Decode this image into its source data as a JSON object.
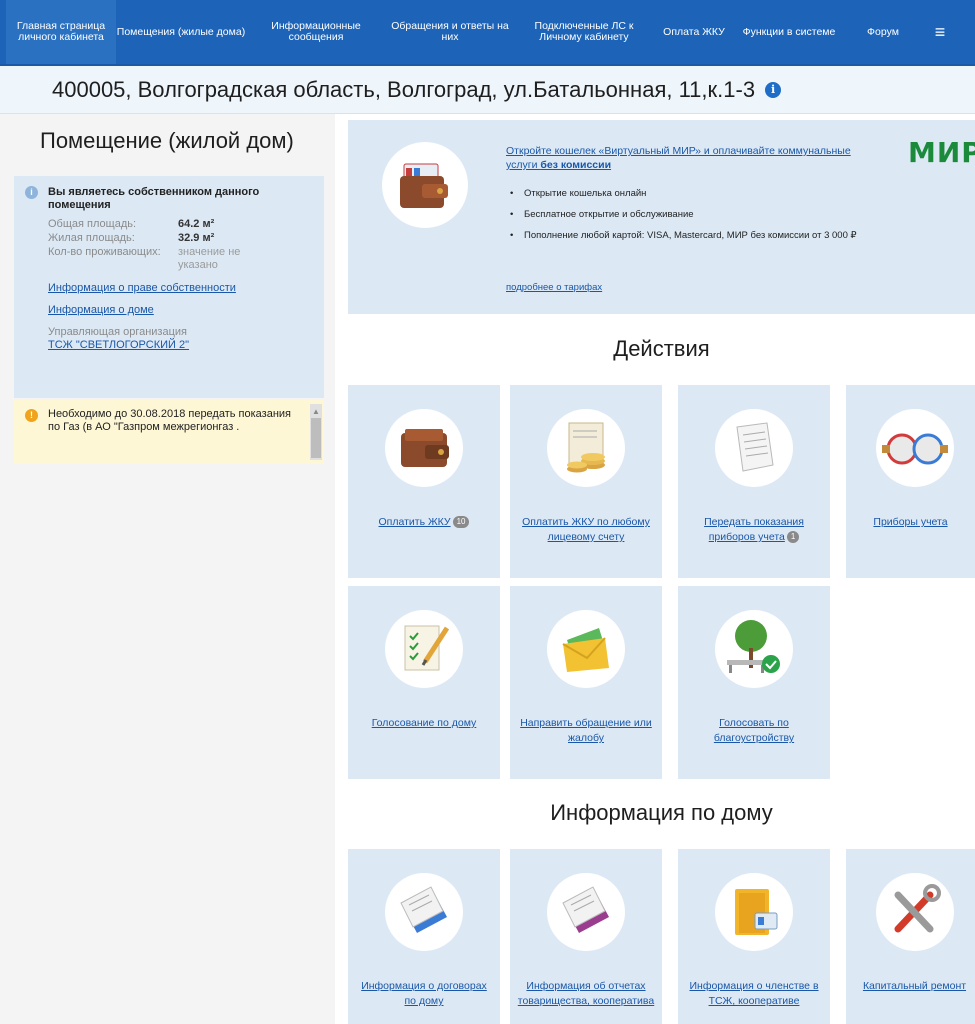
{
  "nav": {
    "home": "Главная страница личного кабинета",
    "items": [
      "Помещения (жилые дома)",
      "Информационные сообщения",
      "Обращения и ответы на них",
      "Подключенные ЛС к Личному кабинету",
      "Оплата ЖКУ",
      "Функции в системе",
      "Форум"
    ],
    "menu_icon": "≡"
  },
  "address": {
    "text": "400005, Волгоградская область, Волгоград, ул.Батальонная, 11,к.1-3",
    "info_icon": "i"
  },
  "sidebar": {
    "title": "Помещение (жилой дом)",
    "owner": {
      "heading": "Вы являетесь собственником данного помещения",
      "rows": [
        {
          "label": "Общая площадь:",
          "value": "64.2 м²"
        },
        {
          "label": "Жилая площадь:",
          "value": "32.9 м²"
        },
        {
          "label": "Кол-во проживающих:",
          "value": "значение не указано"
        }
      ],
      "link_ownership": "Информация о праве собственности",
      "link_house": "Информация о доме",
      "mgmt_label": "Управляющая организация",
      "mgmt_link": "ТСЖ \"СВЕТЛОГОРСКИЙ 2\""
    },
    "notice": "Необходимо до 30.08.2018 передать показания по Газ (в АО \"Газпром межрегионгаз ."
  },
  "promo": {
    "link_text": "Откройте кошелек «Виртуальный МИР» и оплачивайте коммунальные услуги ",
    "link_bold": "без комиссии",
    "bullets": [
      "Открытие кошелька онлайн",
      "Бесплатное открытие и обслуживание",
      "Пополнение любой картой: VISA, Mastercard, МИР без комиссии от 3 000 ₽"
    ],
    "more": "подробнее о тарифах",
    "logo": "МИР"
  },
  "actions": {
    "title": "Действия",
    "tiles": [
      {
        "label": "Оплатить ЖКУ",
        "badge": "10"
      },
      {
        "label": "Оплатить ЖКУ по любому лицевому счету"
      },
      {
        "label": "Передать показания приборов учета",
        "badge": "1"
      },
      {
        "label": "Приборы учета"
      },
      {
        "label": "Голосование по дому"
      },
      {
        "label": "Направить обращение или жалобу"
      },
      {
        "label": "Голосовать по благоустройству"
      }
    ]
  },
  "house_info": {
    "title": "Информация по дому",
    "tiles": [
      {
        "label": "Информация о договорах по дому"
      },
      {
        "label": "Информация об отчетах товарищества, кооператива"
      },
      {
        "label": "Информация о членстве в ТСЖ, кооперативе"
      },
      {
        "label": "Капитальный ремонт"
      }
    ]
  },
  "colors": {
    "nav": "#1d64b8",
    "panel": "#dce9f5",
    "link": "#1a57a8",
    "notice": "#fdf7d6",
    "mir_green": "#1b8a3b"
  }
}
